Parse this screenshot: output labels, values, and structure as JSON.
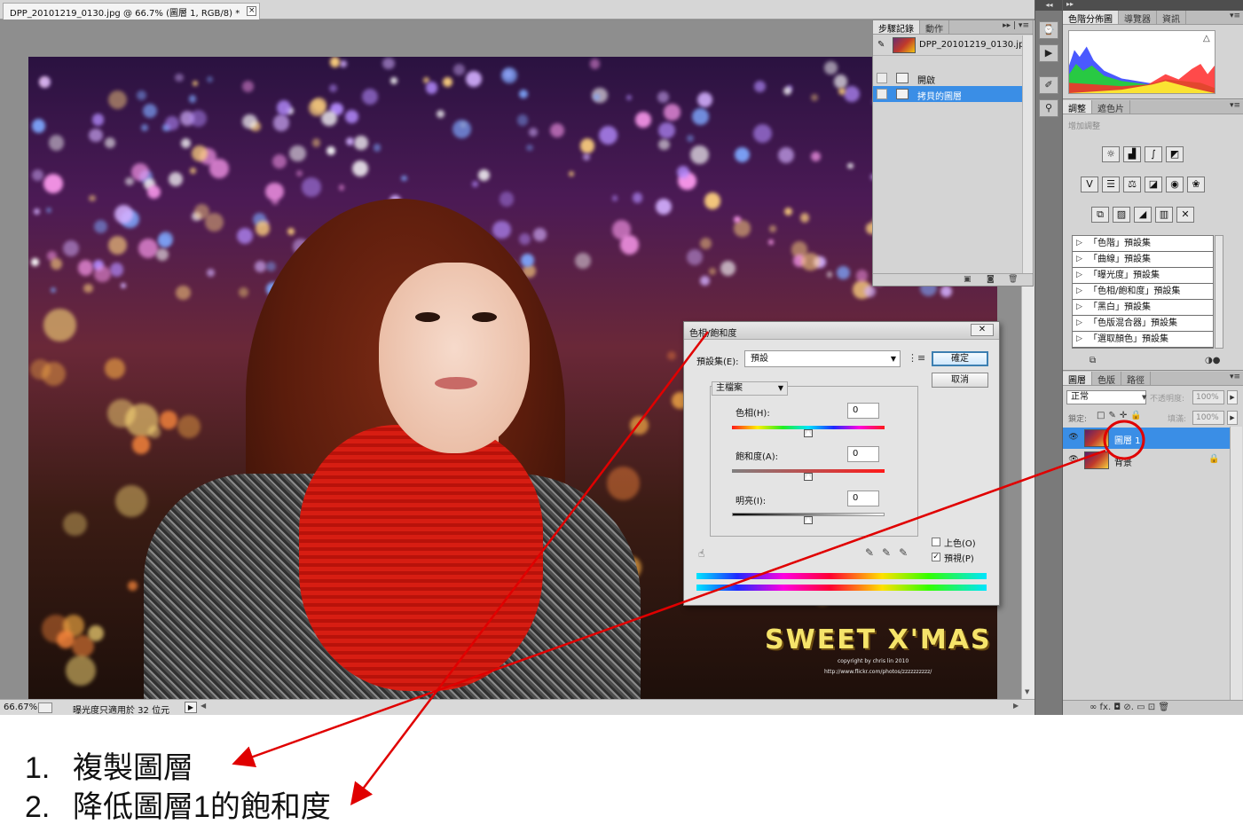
{
  "document": {
    "tab_title": "DPP_20101219_0130.jpg @ 66.7% (圖層 1, RGB/8) *",
    "tab_close": "×",
    "zoom": "66.67%",
    "status_message": "曝光度只適用於 32 位元",
    "watermark_title": "SWEET X'MAS",
    "watermark_copyright": "copyright by chris lin 2010",
    "watermark_url": "http://www.flickr.com/photos/zzzzzzzzzz/"
  },
  "history": {
    "tabs": [
      "步驟記錄",
      "動作"
    ],
    "menu": "▸▸ | ▾≡",
    "snapshot_label": "DPP_20101219_0130.jpg",
    "items": [
      {
        "label": "開啟"
      },
      {
        "label": "拷貝的圖層"
      }
    ]
  },
  "histogram": {
    "tabs": [
      "色階分佈圖",
      "導覽器",
      "資訊"
    ],
    "warning_icon": "△",
    "colors": {
      "red": "#ff2a2a",
      "green": "#22dd22",
      "blue": "#2a3cff",
      "yellow": "#ffff33",
      "cyan": "#33ddff"
    }
  },
  "adjustments": {
    "tabs": [
      "調整",
      "遮色片"
    ],
    "hint": "增加調整",
    "presets": [
      "「色階」預設集",
      "「曲線」預設集",
      "「曝光度」預設集",
      "「色相/飽和度」預設集",
      "「黑白」預設集",
      "「色版混合器」預設集",
      "「選取顏色」預設集"
    ]
  },
  "layers": {
    "tabs": [
      "圖層",
      "色版",
      "路徑"
    ],
    "blend_mode": "正常",
    "opacity_label": "不透明度:",
    "opacity_value": "100%",
    "lock_label": "鎖定:",
    "fill_label": "填滿:",
    "fill_value": "100%",
    "rows": [
      {
        "name": "圖層 1",
        "selected": true
      },
      {
        "name": "背景",
        "selected": false
      }
    ],
    "footer_icons": "∞  fx.  ◘  ⊘.  ▭  ⊡  🗑"
  },
  "dialog": {
    "title": "色相/飽和度",
    "close": "✕",
    "preset_label": "預設集(E):",
    "preset_value": "預設",
    "ok": "確定",
    "cancel": "取消",
    "channel": "主檔案",
    "hue_label": "色相(H):",
    "hue_value": "0",
    "saturation_label": "飽和度(A):",
    "saturation_value": "0",
    "lightness_label": "明亮(I):",
    "lightness_value": "0",
    "colorize_label": "上色(O)",
    "preview_label": "預視(P)",
    "preview_checked": "✓"
  },
  "annotations": {
    "steps": [
      {
        "num": "1.",
        "text": "複製圖層"
      },
      {
        "num": "2.",
        "text": "降低圖層1的飽和度"
      }
    ],
    "arrow_color": "#e00000"
  }
}
